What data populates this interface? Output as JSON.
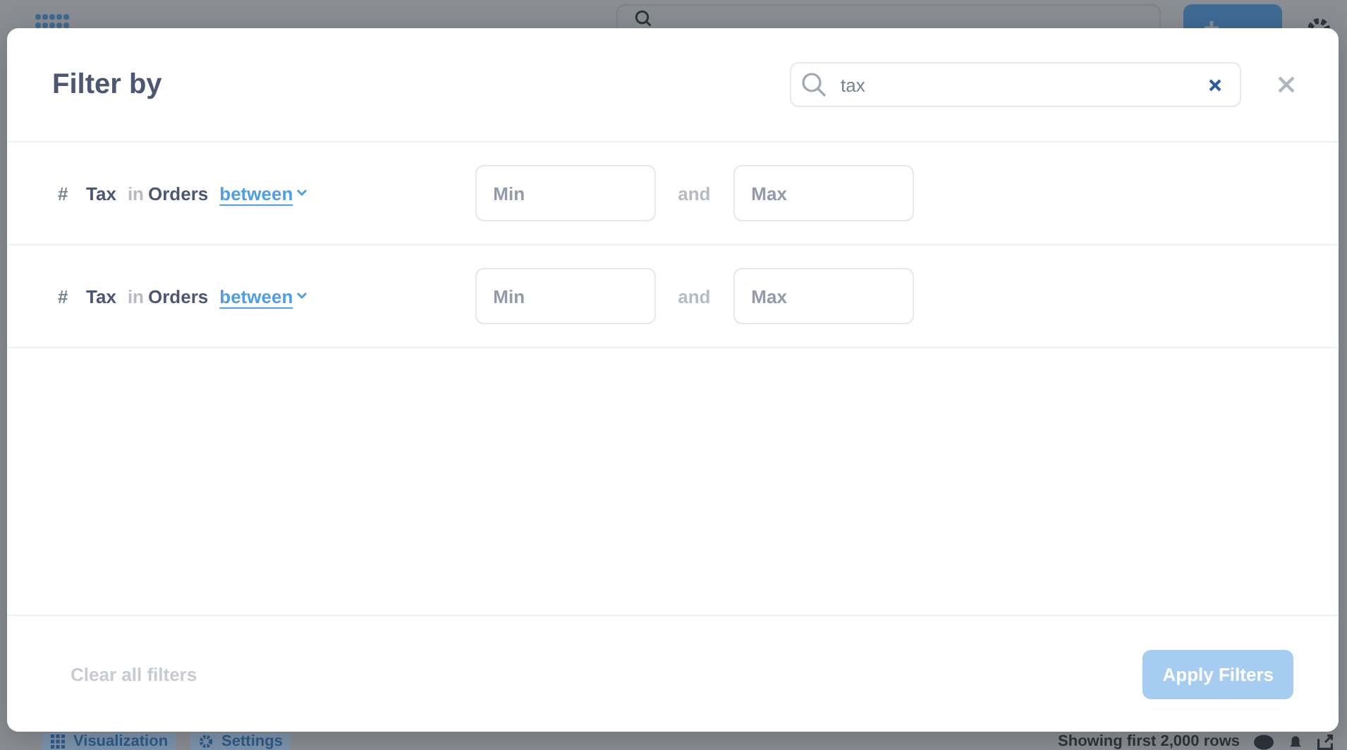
{
  "app": {
    "bottom_bar": {
      "tabs": [
        "Visualization",
        "Settings"
      ],
      "row_count": "Showing first 2,000 rows"
    }
  },
  "modal": {
    "title": "Filter by",
    "search": {
      "value": "tax"
    },
    "filters": [
      {
        "field_icon": "#",
        "field": "Tax",
        "in_label": "in",
        "table": "Orders",
        "operator": "between",
        "min_placeholder": "Min",
        "and_label": "and",
        "max_placeholder": "Max"
      },
      {
        "field_icon": "#",
        "field": "Tax",
        "in_label": "in",
        "table": "Orders",
        "operator": "between",
        "min_placeholder": "Min",
        "and_label": "and",
        "max_placeholder": "Max"
      }
    ],
    "footer": {
      "clear_button": {
        "label": "Clear all filters",
        "disabled": true
      },
      "apply_button": {
        "label": "Apply Filters",
        "disabled": true
      }
    }
  }
}
